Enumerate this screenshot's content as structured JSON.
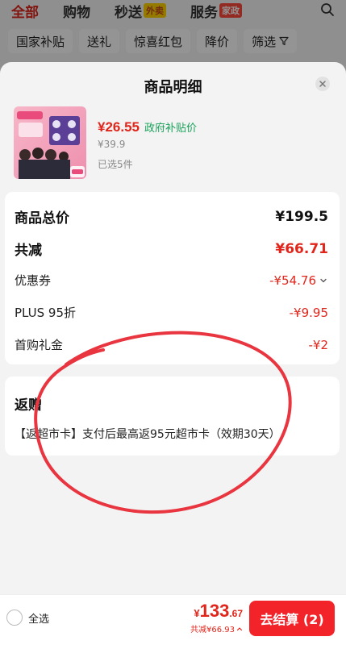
{
  "background": {
    "nav_tabs": [
      {
        "label": "全部",
        "tag": ""
      },
      {
        "label": "购物",
        "tag": ""
      },
      {
        "label": "秒送",
        "tag": "外卖"
      },
      {
        "label": "服务",
        "tag": "家政"
      }
    ],
    "filters": [
      "国家补贴",
      "送礼",
      "惊喜红包",
      "降价",
      "筛选"
    ]
  },
  "sheet": {
    "title": "商品明细",
    "product": {
      "price": "¥26.55",
      "price_tag": "政府补贴价",
      "original_price": "¥39.9",
      "selected": "已选5件"
    },
    "summary": {
      "total_label": "商品总价",
      "total_value": "¥199.5",
      "reduce_label": "共减",
      "reduce_value": "¥66.71",
      "coupon_label": "优惠券",
      "coupon_value": "-¥54.76",
      "plus_label": "PLUS 95折",
      "plus_value": "-¥9.95",
      "first_label": "首购礼金",
      "first_value": "-¥2"
    },
    "rebate": {
      "title": "返赠",
      "text": "【返超市卡】支付后最高返95元超市卡（效期30天）"
    }
  },
  "bottom_bar": {
    "select_all": "全选",
    "currency": "¥",
    "price_int": "133",
    "price_dec": ".67",
    "discount": "共减¥66.93",
    "checkout": "去结算 (2)"
  },
  "colors": {
    "accent_red": "#e1251b",
    "subsidy_green": "#19a05a",
    "annotation_red": "#e8353f"
  }
}
